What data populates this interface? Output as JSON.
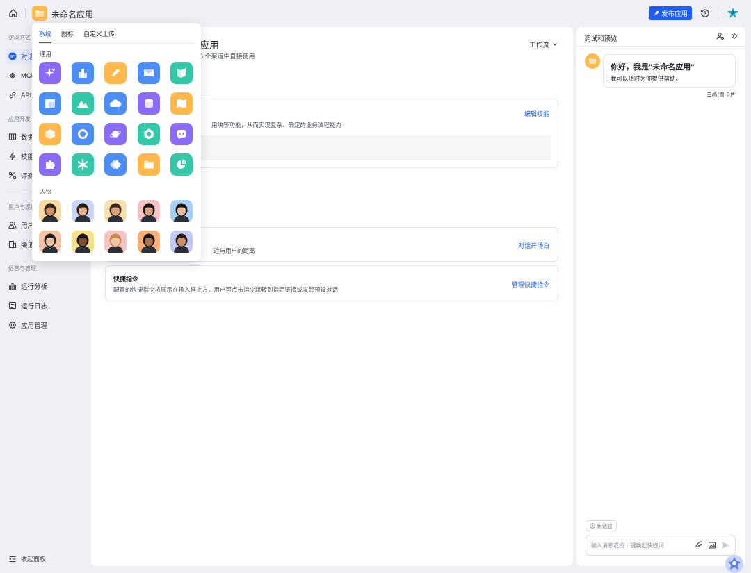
{
  "topbar": {
    "app_title": "未命名应用",
    "publish_label": "发布应用"
  },
  "sidebar": {
    "sections": [
      "访问方式",
      "应用开发",
      "用户与渠道",
      "运营与管理"
    ],
    "items": [
      {
        "label": "对话",
        "icon": "chat-icon",
        "active": true
      },
      {
        "label": "MCP",
        "icon": "mcp-icon"
      },
      {
        "label": "API",
        "icon": "link-icon"
      },
      {
        "label": "数据",
        "icon": "database-icon"
      },
      {
        "label": "技能",
        "icon": "bolt-icon"
      },
      {
        "label": "评测",
        "icon": "eval-icon"
      },
      {
        "label": "用户",
        "icon": "users-icon"
      },
      {
        "label": "渠道",
        "icon": "channel-icon"
      },
      {
        "label": "运行分析",
        "icon": "bar-chart-icon"
      },
      {
        "label": "运行日志",
        "icon": "log-icon"
      },
      {
        "label": "应用管理",
        "icon": "gear-icon"
      }
    ],
    "collapse_label": "收起面板"
  },
  "main": {
    "title": "应用",
    "subtitle": "5 个渠道中直接使用",
    "workflow_label": "工作流",
    "skill_card": {
      "desc": "用块等功能，从而实现复杂、确定的业务流程能力",
      "link": "编辑技能"
    },
    "opening_card": {
      "desc": "近与用户的距离",
      "link": "对话开场白"
    },
    "shortcut_card": {
      "title": "快捷指令",
      "desc": "配置的快捷指令将展示在输入框上方，用户可点击指令跳转到指定链接或发起预设对话",
      "link": "管理快捷指令"
    }
  },
  "preview": {
    "title": "调试和预览",
    "greeting_title": "你好，我是\"未命名应用\"",
    "greeting_text": "我可以随时为你提供帮助。",
    "config_card": "配置卡片",
    "new_topic": "新话题",
    "input_placeholder": "输入消息或按 ↑ 键唤起快捷词"
  },
  "icon_picker": {
    "tabs": [
      "系统",
      "图标",
      "自定义上传"
    ],
    "active_tab": "系统",
    "group_general": "通用",
    "group_people": "人物",
    "general_icons": [
      {
        "name": "sparkle-icon",
        "color": "#8b6cf6"
      },
      {
        "name": "buildings-icon",
        "color": "#4c8df6"
      },
      {
        "name": "pencil-icon",
        "color": "#ffb84d"
      },
      {
        "name": "mail-icon",
        "color": "#4c8df6"
      },
      {
        "name": "book-icon",
        "color": "#34c7a8"
      },
      {
        "name": "window-icon",
        "color": "#4c8df6"
      },
      {
        "name": "mountain-icon",
        "color": "#34c7a8"
      },
      {
        "name": "cloud-icon",
        "color": "#4c8df6"
      },
      {
        "name": "stack-icon",
        "color": "#8b6cf6"
      },
      {
        "name": "map-icon",
        "color": "#ffb84d"
      },
      {
        "name": "cube-icon",
        "color": "#ffb84d"
      },
      {
        "name": "ring-icon",
        "color": "#4c8df6"
      },
      {
        "name": "planet-icon",
        "color": "#8b6cf6"
      },
      {
        "name": "hexagon-icon",
        "color": "#34c7a8"
      },
      {
        "name": "bot-icon",
        "color": "#8b6cf6"
      },
      {
        "name": "puzzle-icon",
        "color": "#8b6cf6"
      },
      {
        "name": "asterisk-icon",
        "color": "#34c7a8"
      },
      {
        "name": "diamond-icon",
        "color": "#4c8df6"
      },
      {
        "name": "folder-icon",
        "color": "#ffb84d"
      },
      {
        "name": "pie-chart-icon",
        "color": "#34c7a8"
      }
    ],
    "people": [
      {
        "name": "person-avatar",
        "bg": "#f7d9a8",
        "skin": "#c98d68",
        "hair": "#3a2518"
      },
      {
        "name": "person-avatar",
        "bg": "#c9d6f5",
        "skin": "#e0b08f",
        "hair": "#2a1a12"
      },
      {
        "name": "person-avatar",
        "bg": "#f7e0b0",
        "skin": "#d9a17d",
        "hair": "#3a2518"
      },
      {
        "name": "person-avatar",
        "bg": "#f5c4c4",
        "skin": "#d8a484",
        "hair": "#1a1412"
      },
      {
        "name": "person-avatar",
        "bg": "#a8d0f5",
        "skin": "#e8c09f",
        "hair": "#1a1412"
      },
      {
        "name": "person-avatar",
        "bg": "#f7c4a8",
        "skin": "#e8c09f",
        "hair": "#222"
      },
      {
        "name": "person-avatar",
        "bg": "#f7e08a",
        "skin": "#7a4e33",
        "hair": "#1a1210"
      },
      {
        "name": "person-avatar",
        "bg": "#f5c4c4",
        "skin": "#f0c8a8",
        "hair": "#c88a4a"
      },
      {
        "name": "person-avatar",
        "bg": "#f7b07a",
        "skin": "#a8714f",
        "hair": "#1a1210"
      },
      {
        "name": "person-avatar",
        "bg": "#c4c8f5",
        "skin": "#c98d68",
        "hair": "#2a1a12"
      }
    ]
  }
}
